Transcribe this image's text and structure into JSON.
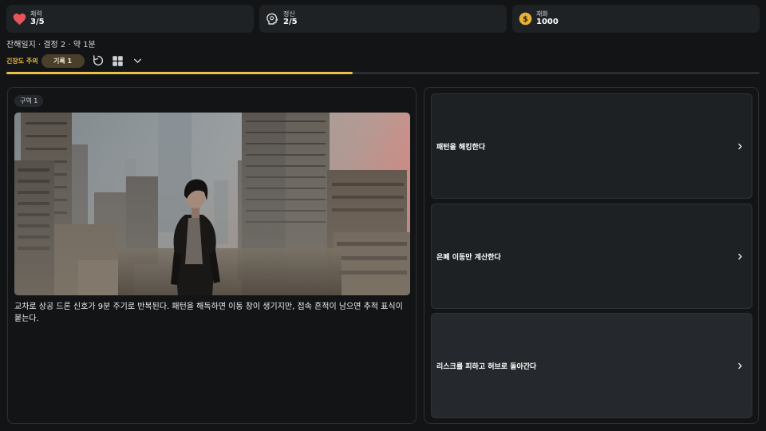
{
  "stats": [
    {
      "label": "체력",
      "value": "3/5",
      "icon": "heart-icon",
      "color": "#e8545a"
    },
    {
      "label": "정신",
      "value": "2/5",
      "icon": "brain-head-icon",
      "color": "#d8d8d8"
    },
    {
      "label": "재화",
      "value": "1000",
      "icon": "coin-icon",
      "color": "#e8b23a"
    }
  ],
  "meta": "잔해일지 · 결정 2 · 약 1분",
  "controls": {
    "tension": "긴장도 주의",
    "record": "기록 1"
  },
  "progress": 0.46,
  "scene": {
    "area": "구역 1",
    "narration": "교차로 상공 드론 신호가 9분 주기로 반복된다. 패턴을 해독하면 이동 창이 생기지만, 접속 흔적이 남으면 추적 표식이 붙는다."
  },
  "choices": [
    {
      "label": "패턴을 해킹한다"
    },
    {
      "label": "은폐 이동만 계산한다"
    },
    {
      "label": "리스크를 피하고 허브로 돌아간다"
    }
  ],
  "colors": {
    "accent": "#e8c04a",
    "tension": "#e8b84a"
  }
}
